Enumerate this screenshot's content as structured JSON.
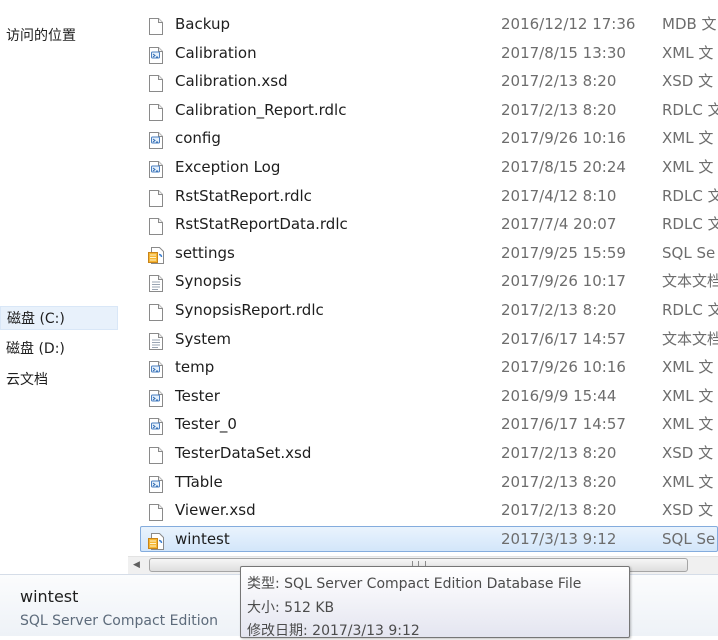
{
  "nav": {
    "items": [
      {
        "label": "访问的位置",
        "selected": false
      },
      {
        "label": "磁盘 (C:)",
        "selected": true
      },
      {
        "label": "磁盘 (D:)",
        "selected": false
      },
      {
        "label": "云文档",
        "selected": false
      }
    ]
  },
  "files": [
    {
      "name": "Backup",
      "date": "2016/12/12 17:36",
      "type": "MDB 文",
      "icon": "blank-document-icon"
    },
    {
      "name": "Calibration",
      "date": "2017/8/15 13:30",
      "type": "XML 文",
      "icon": "xml-document-icon"
    },
    {
      "name": "Calibration.xsd",
      "date": "2017/2/13 8:20",
      "type": "XSD 文",
      "icon": "blank-document-icon"
    },
    {
      "name": "Calibration_Report.rdlc",
      "date": "2017/2/13 8:20",
      "type": "RDLC 文",
      "icon": "blank-document-icon"
    },
    {
      "name": "config",
      "date": "2017/9/26 10:16",
      "type": "XML 文",
      "icon": "xml-document-icon"
    },
    {
      "name": "Exception Log",
      "date": "2017/8/15 20:24",
      "type": "XML 文",
      "icon": "xml-document-icon"
    },
    {
      "name": "RstStatReport.rdlc",
      "date": "2017/4/12 8:10",
      "type": "RDLC 文",
      "icon": "blank-document-icon"
    },
    {
      "name": "RstStatReportData.rdlc",
      "date": "2017/7/4 20:07",
      "type": "RDLC 文",
      "icon": "blank-document-icon"
    },
    {
      "name": "settings",
      "date": "2017/9/25 15:59",
      "type": "SQL Se",
      "icon": "sql-database-icon"
    },
    {
      "name": "Synopsis",
      "date": "2017/9/26 10:17",
      "type": "文本文档",
      "icon": "text-document-icon"
    },
    {
      "name": "SynopsisReport.rdlc",
      "date": "2017/2/13 8:20",
      "type": "RDLC 文",
      "icon": "blank-document-icon"
    },
    {
      "name": "System",
      "date": "2017/6/17 14:57",
      "type": "文本文档",
      "icon": "text-document-icon"
    },
    {
      "name": "temp",
      "date": "2017/9/26 10:16",
      "type": "XML 文",
      "icon": "xml-document-icon"
    },
    {
      "name": "Tester",
      "date": "2016/9/9 15:44",
      "type": "XML 文",
      "icon": "xml-document-icon"
    },
    {
      "name": "Tester_0",
      "date": "2017/6/17 14:57",
      "type": "XML 文",
      "icon": "xml-document-icon"
    },
    {
      "name": "TesterDataSet.xsd",
      "date": "2017/2/13 8:20",
      "type": "XSD 文",
      "icon": "blank-document-icon"
    },
    {
      "name": "TTable",
      "date": "2017/2/13 8:20",
      "type": "XML 文",
      "icon": "xml-document-icon"
    },
    {
      "name": "Viewer.xsd",
      "date": "2017/2/13 8:20",
      "type": "XSD 文",
      "icon": "blank-document-icon"
    },
    {
      "name": "wintest",
      "date": "2017/3/13 9:12",
      "type": "SQL Se",
      "icon": "sql-database-icon",
      "selected": true
    }
  ],
  "details": {
    "name": "wintest",
    "type": "SQL Server Compact Edition"
  },
  "tooltip": {
    "type_line": "类型: SQL Server Compact Edition Database File",
    "size_line": "大小: 512 KB",
    "modified_line": "修改日期: 2017/3/13 9:12"
  },
  "colors": {
    "selection_border": "#84acdd",
    "selection_fill": "#d3e6fa",
    "secondary_text": "#6d6d6d"
  }
}
